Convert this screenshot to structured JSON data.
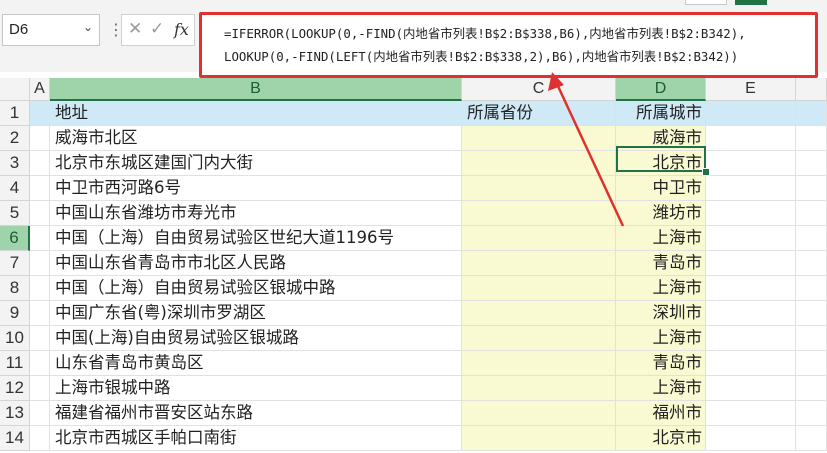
{
  "name_box": {
    "value": "D6",
    "dropdown_icon": "chevron-down-icon"
  },
  "formula_bar": {
    "cancel_icon": "close-icon",
    "enter_icon": "checkmark-icon",
    "fx_label": "fx",
    "formula_line1": "=IFERROR(LOOKUP(0,-FIND(内地省市列表!B$2:B$338,B6),内地省市列表!B$2:B342),",
    "formula_line2": "LOOKUP(0,-FIND(LEFT(内地省市列表!B$2:B$338,2),B6),内地省市列表!B$2:B342))"
  },
  "columns": [
    "A",
    "B",
    "C",
    "D",
    "E"
  ],
  "selected_cell": "D6",
  "rows": [
    {
      "num": "1",
      "b": "地址",
      "c": "所属省份",
      "d": "所属城市"
    },
    {
      "num": "2",
      "b": "威海市北区",
      "c": "",
      "d": "威海市"
    },
    {
      "num": "3",
      "b": "北京市东城区建国门内大街",
      "c": "",
      "d": "北京市"
    },
    {
      "num": "4",
      "b": "中卫市西河路6号",
      "c": "",
      "d": "中卫市"
    },
    {
      "num": "5",
      "b": "中国山东省潍坊市寿光市",
      "c": "",
      "d": "潍坊市"
    },
    {
      "num": "6",
      "b": "中国（上海）自由贸易试验区世纪大道1196号",
      "c": "",
      "d": "上海市"
    },
    {
      "num": "7",
      "b": "中国山东省青岛市市北区人民路",
      "c": "",
      "d": "青岛市"
    },
    {
      "num": "8",
      "b": "中国（上海）自由贸易试验区银城中路",
      "c": "",
      "d": "上海市"
    },
    {
      "num": "9",
      "b": "中国广东省(粤)深圳市罗湖区",
      "c": "",
      "d": "深圳市"
    },
    {
      "num": "10",
      "b": "中国(上海)自由贸易试验区银城路",
      "c": "",
      "d": "上海市"
    },
    {
      "num": "11",
      "b": "山东省青岛市黄岛区",
      "c": "",
      "d": "青岛市"
    },
    {
      "num": "12",
      "b": "上海市银城中路",
      "c": "",
      "d": "上海市"
    },
    {
      "num": "13",
      "b": "福建省福州市晋安区站东路",
      "c": "",
      "d": "福州市"
    },
    {
      "num": "14",
      "b": "北京市西城区手帕口南街",
      "c": "",
      "d": "北京市"
    }
  ],
  "colors": {
    "highlight_red": "#e03030",
    "excel_green": "#217346",
    "header_blue": "#cfeaf6",
    "column_yellow": "#fafad2"
  }
}
